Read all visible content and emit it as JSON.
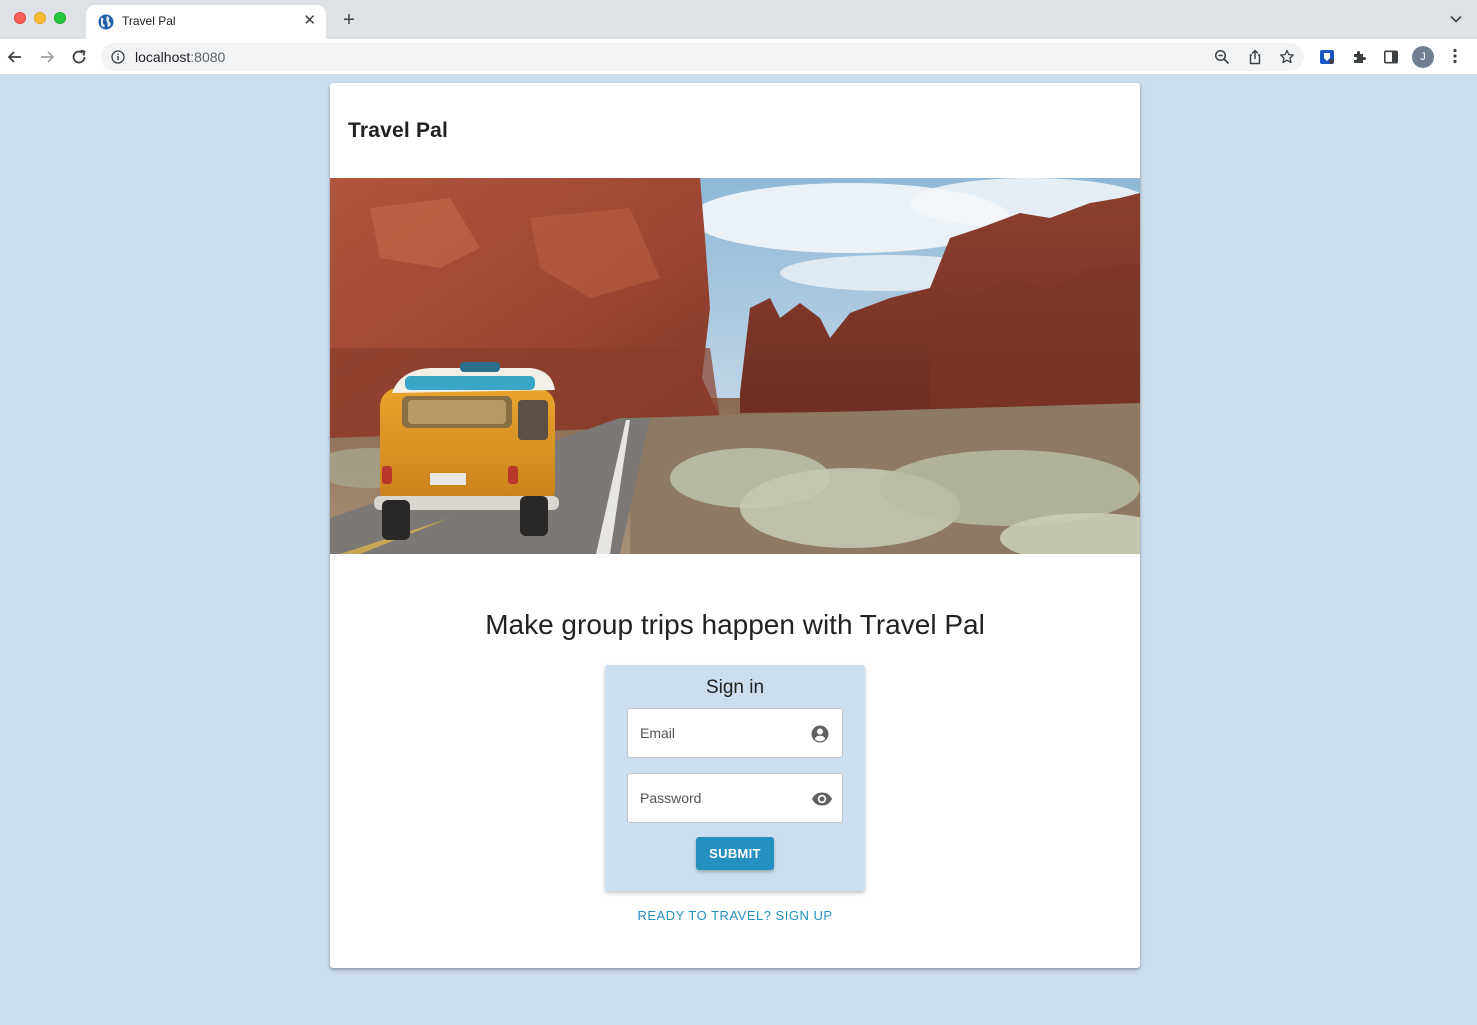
{
  "browser": {
    "tab_title": "Travel Pal",
    "url_host": "localhost",
    "url_port": ":8080",
    "profile_initial": "J"
  },
  "page": {
    "app_title": "Travel Pal",
    "hero_image": "yellow camper van on desert road between red rock canyons",
    "headline": "Make group trips happen with Travel Pal",
    "signin": {
      "title": "Sign in",
      "email_placeholder": "Email",
      "password_placeholder": "Password",
      "submit_label": "SUBMIT"
    },
    "signup_link": "READY TO TRAVEL? SIGN UP"
  },
  "colors": {
    "page_background": "#cddfee",
    "accent": "#2490c0"
  }
}
